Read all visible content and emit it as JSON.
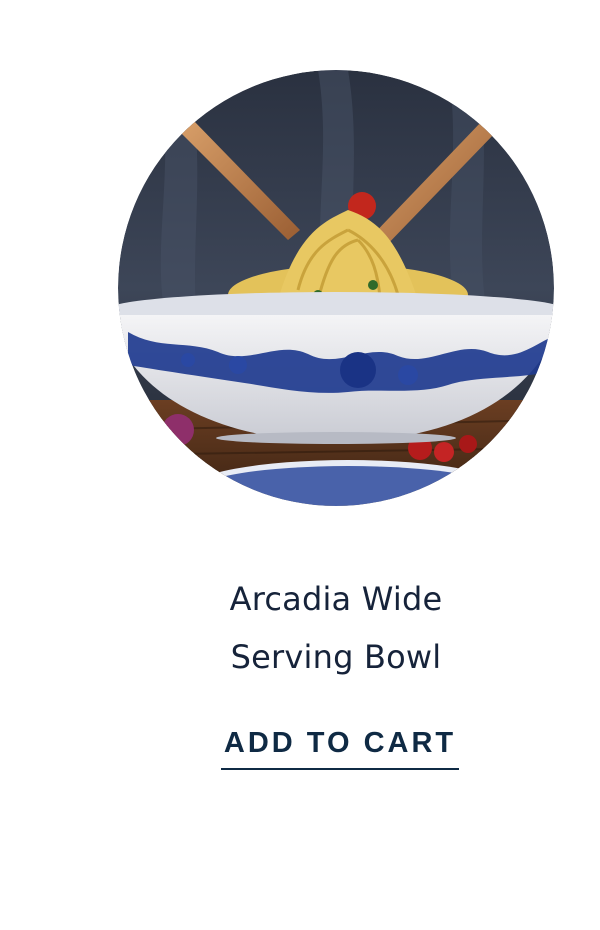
{
  "product": {
    "image_alt": "Spaghetti being served with wooden tongs from a white bowl with blue floral pattern",
    "title_line_1": "Arcadia Wide",
    "title_line_2": "Serving Bowl",
    "cta_label": "ADD TO CART"
  },
  "colors": {
    "title_text": "#16233a",
    "cta_text": "#0f2a44",
    "background": "#ffffff",
    "bowl_blue": "#1f3b8f"
  }
}
